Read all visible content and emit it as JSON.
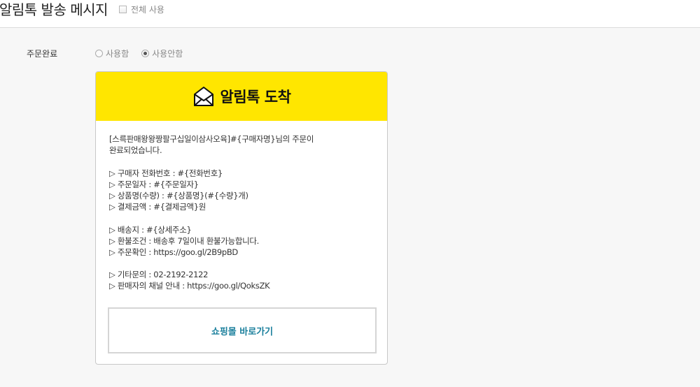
{
  "header": {
    "title": "알림톡 발송 메시지",
    "all_use_label": "전체 사용"
  },
  "setting_row": {
    "label": "주문완료",
    "options": [
      {
        "label": "사용함",
        "checked": false
      },
      {
        "label": "사용안함",
        "checked": true
      }
    ]
  },
  "card": {
    "title": "알림톡 도착",
    "header_color": "#ffe600",
    "icon": "envelope-icon",
    "message": {
      "intro": [
        "[스륵판매왕왕짱팔구십일이삼사오육]#{구매자명}님의 주문이",
        "완료되었습니다."
      ],
      "group1": [
        "▷ 구매자 전화번호 : #{전화번호}",
        "▷ 주문일자 : #{주문일자}",
        "▷ 상품명(수량) : #{상품명}(#{수량}개)",
        "▷ 결제금액 : #{결제금액}원"
      ],
      "group2": [
        "▷ 배송지 : #{상세주소}",
        "▷ 환불조건 : 배송후 7일이내 환불가능합니다.",
        "▷ 주문확인 : https://goo.gl/2B9pBD"
      ],
      "group3": [
        "▷ 기타문의 : 02-2192-2122",
        "▷ 판매자의 채널 안내 : https://goo.gl/QoksZK"
      ]
    },
    "button_label": "쇼핑몰 바로가기",
    "button_color": "#1a7f9c"
  }
}
